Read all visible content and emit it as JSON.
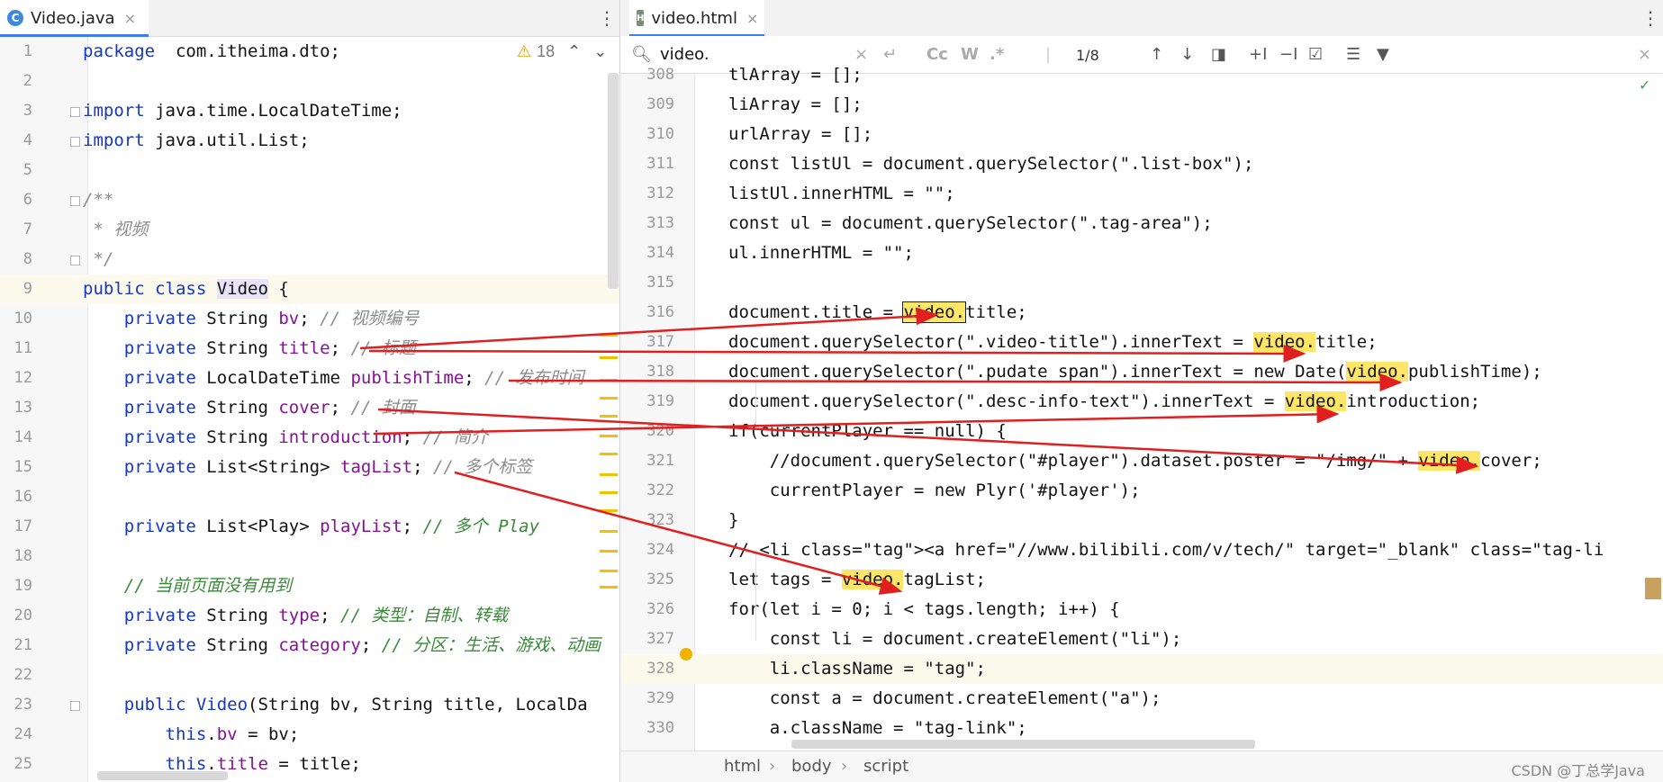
{
  "left_tab": {
    "icon": "C",
    "title": "Video.java",
    "close": "×"
  },
  "right_tab": {
    "icon": "H",
    "title": "video.html",
    "close": "×"
  },
  "inspection": {
    "icon": "⚠",
    "count": "18",
    "up": "⌃",
    "down": "⌄"
  },
  "search": {
    "query": "video.",
    "clear": "×",
    "case_label": "Cc",
    "words_label": "W",
    "regex_label": ".*",
    "match_count": "1/8"
  },
  "java_lines": [
    {
      "n": "1",
      "segs": [
        [
          "kw",
          "package"
        ],
        [
          "",
          "  com.itheima.dto;"
        ]
      ]
    },
    {
      "n": "2",
      "segs": []
    },
    {
      "n": "3",
      "segs": [
        [
          "kw",
          "import"
        ],
        [
          "",
          " java.time.LocalDateTime;"
        ]
      ]
    },
    {
      "n": "4",
      "segs": [
        [
          "kw",
          "import"
        ],
        [
          "",
          " java.util.List;"
        ]
      ]
    },
    {
      "n": "5",
      "segs": []
    },
    {
      "n": "6",
      "segs": [
        [
          "cm",
          "/**"
        ]
      ]
    },
    {
      "n": "7",
      "segs": [
        [
          "cm",
          " * 视频"
        ]
      ]
    },
    {
      "n": "8",
      "segs": [
        [
          "cm",
          " */"
        ]
      ]
    },
    {
      "n": "9",
      "segs": [
        [
          "kw",
          "public class "
        ],
        [
          "cls-hl",
          "Video"
        ],
        [
          "",
          " {"
        ]
      ]
    },
    {
      "n": "10",
      "segs": [
        [
          "",
          "    "
        ],
        [
          "kw",
          "private"
        ],
        [
          "",
          " String "
        ],
        [
          "fld",
          "bv"
        ],
        [
          "",
          "; "
        ],
        [
          "cm",
          "// 视频编号"
        ]
      ]
    },
    {
      "n": "11",
      "segs": [
        [
          "",
          "    "
        ],
        [
          "kw",
          "private"
        ],
        [
          "",
          " String "
        ],
        [
          "fld",
          "title"
        ],
        [
          "",
          "; "
        ],
        [
          "cm",
          "// 标题"
        ]
      ]
    },
    {
      "n": "12",
      "segs": [
        [
          "",
          "    "
        ],
        [
          "kw",
          "private"
        ],
        [
          "",
          " LocalDateTime "
        ],
        [
          "fld",
          "publishTime"
        ],
        [
          "",
          "; "
        ],
        [
          "cm",
          "// 发布时间"
        ]
      ]
    },
    {
      "n": "13",
      "segs": [
        [
          "",
          "    "
        ],
        [
          "kw",
          "private"
        ],
        [
          "",
          " String "
        ],
        [
          "fld",
          "cover"
        ],
        [
          "",
          "; "
        ],
        [
          "cm",
          "// 封面"
        ]
      ]
    },
    {
      "n": "14",
      "segs": [
        [
          "",
          "    "
        ],
        [
          "kw",
          "private"
        ],
        [
          "",
          " String "
        ],
        [
          "fld",
          "introduction"
        ],
        [
          "",
          "; "
        ],
        [
          "cm",
          "// 简介"
        ]
      ]
    },
    {
      "n": "15",
      "segs": [
        [
          "",
          "    "
        ],
        [
          "kw",
          "private"
        ],
        [
          "",
          " List<String> "
        ],
        [
          "fld",
          "tagList"
        ],
        [
          "",
          "; "
        ],
        [
          "cm",
          "// 多个标签"
        ]
      ]
    },
    {
      "n": "16",
      "segs": []
    },
    {
      "n": "17",
      "segs": [
        [
          "",
          "    "
        ],
        [
          "kw",
          "private"
        ],
        [
          "",
          " List<Play> "
        ],
        [
          "fld",
          "playList"
        ],
        [
          "",
          "; "
        ],
        [
          "cmz",
          "// 多个 Play"
        ]
      ]
    },
    {
      "n": "18",
      "segs": []
    },
    {
      "n": "19",
      "segs": [
        [
          "",
          "    "
        ],
        [
          "cmz",
          "// 当前页面没有用到"
        ]
      ]
    },
    {
      "n": "20",
      "segs": [
        [
          "",
          "    "
        ],
        [
          "kw",
          "private"
        ],
        [
          "",
          " String "
        ],
        [
          "fld",
          "type"
        ],
        [
          "",
          "; "
        ],
        [
          "cmz",
          "// 类型：自制、转载"
        ]
      ]
    },
    {
      "n": "21",
      "segs": [
        [
          "",
          "    "
        ],
        [
          "kw",
          "private"
        ],
        [
          "",
          " String "
        ],
        [
          "fld",
          "category"
        ],
        [
          "",
          "; "
        ],
        [
          "cmz",
          "// 分区：生活、游戏、动画"
        ]
      ]
    },
    {
      "n": "22",
      "segs": []
    },
    {
      "n": "23",
      "segs": [
        [
          "",
          "    "
        ],
        [
          "kw",
          "public "
        ],
        [
          "kw",
          "Video"
        ],
        [
          "",
          "(String bv, String title, LocalDa"
        ]
      ]
    },
    {
      "n": "24",
      "segs": [
        [
          "",
          "        "
        ],
        [
          "kw",
          "this"
        ],
        [
          "",
          "."
        ],
        [
          "fld",
          "bv"
        ],
        [
          "",
          " = bv;"
        ]
      ]
    },
    {
      "n": "25",
      "segs": [
        [
          "",
          "        "
        ],
        [
          "kw",
          "this"
        ],
        [
          "",
          "."
        ],
        [
          "fld",
          "title"
        ],
        [
          "",
          " = title;"
        ]
      ]
    }
  ],
  "html_lines": [
    {
      "n": "308",
      "segs": [
        [
          "",
          "tlArray = [];"
        ]
      ]
    },
    {
      "n": "309",
      "segs": [
        [
          "",
          "liArray = [];"
        ]
      ]
    },
    {
      "n": "310",
      "segs": [
        [
          "",
          "urlArray = [];"
        ]
      ]
    },
    {
      "n": "311",
      "segs": [
        [
          "",
          "const listUl = document.querySelector(\".list-box\");"
        ]
      ]
    },
    {
      "n": "312",
      "segs": [
        [
          "",
          "listUl.innerHTML = \"\";"
        ]
      ]
    },
    {
      "n": "313",
      "segs": [
        [
          "",
          "const ul = document.querySelector(\".tag-area\");"
        ]
      ]
    },
    {
      "n": "314",
      "segs": [
        [
          "",
          "ul.innerHTML = \"\";"
        ]
      ]
    },
    {
      "n": "315",
      "segs": []
    },
    {
      "n": "316",
      "segs": [
        [
          "",
          "document.title = "
        ],
        [
          "hl-cur",
          "video."
        ],
        [
          "",
          "title;"
        ]
      ]
    },
    {
      "n": "317",
      "segs": [
        [
          "",
          "document.querySelector(\".video-title\").innerText = "
        ],
        [
          "hl",
          "video."
        ],
        [
          "",
          "title;"
        ]
      ]
    },
    {
      "n": "318",
      "segs": [
        [
          "",
          "document.querySelector(\".pudate span\").innerText = new Date("
        ],
        [
          "hl",
          "video."
        ],
        [
          "",
          "publishTime);"
        ]
      ]
    },
    {
      "n": "319",
      "segs": [
        [
          "",
          "document.querySelector(\".desc-info-text\").innerText = "
        ],
        [
          "hl",
          "video."
        ],
        [
          "",
          "introduction;"
        ]
      ]
    },
    {
      "n": "320",
      "segs": [
        [
          "",
          "if(currentPlayer == null) {"
        ]
      ]
    },
    {
      "n": "321",
      "segs": [
        [
          "",
          "    //document.querySelector(\"#player\").dataset.poster = \"/img/\" + "
        ],
        [
          "hl",
          "video."
        ],
        [
          "",
          "cover;"
        ]
      ]
    },
    {
      "n": "322",
      "segs": [
        [
          "",
          "    currentPlayer = new Plyr('#player');"
        ]
      ]
    },
    {
      "n": "323",
      "segs": [
        [
          "",
          "}"
        ]
      ]
    },
    {
      "n": "324",
      "segs": [
        [
          "",
          "// <li class=\"tag\"><a href=\"//www.bilibili.com/v/tech/\" target=\"_blank\" class=\"tag-li"
        ]
      ]
    },
    {
      "n": "325",
      "segs": [
        [
          "",
          "let tags = "
        ],
        [
          "hl",
          "video."
        ],
        [
          "",
          "tagList;"
        ]
      ]
    },
    {
      "n": "326",
      "segs": [
        [
          "",
          "for(let i = 0; i < tags.length; i++) {"
        ]
      ]
    },
    {
      "n": "327",
      "segs": [
        [
          "",
          "    const li = document.createElement(\"li\");"
        ]
      ]
    },
    {
      "n": "328",
      "segs": [
        [
          "",
          "    li.className = \"tag\";"
        ]
      ]
    },
    {
      "n": "329",
      "segs": [
        [
          "",
          "    const a = document.createElement(\"a\");"
        ]
      ]
    },
    {
      "n": "330",
      "segs": [
        [
          "",
          "    a.className = \"tag-link\";"
        ]
      ]
    }
  ],
  "breadcrumbs": [
    "html",
    "body",
    "script"
  ],
  "breadcrumb_sep": "›",
  "watermark": "CSDN @丁总学Java",
  "colors": {
    "arrow": "#e02020",
    "highlight": "#fde568",
    "accent": "#3d7cf5"
  }
}
